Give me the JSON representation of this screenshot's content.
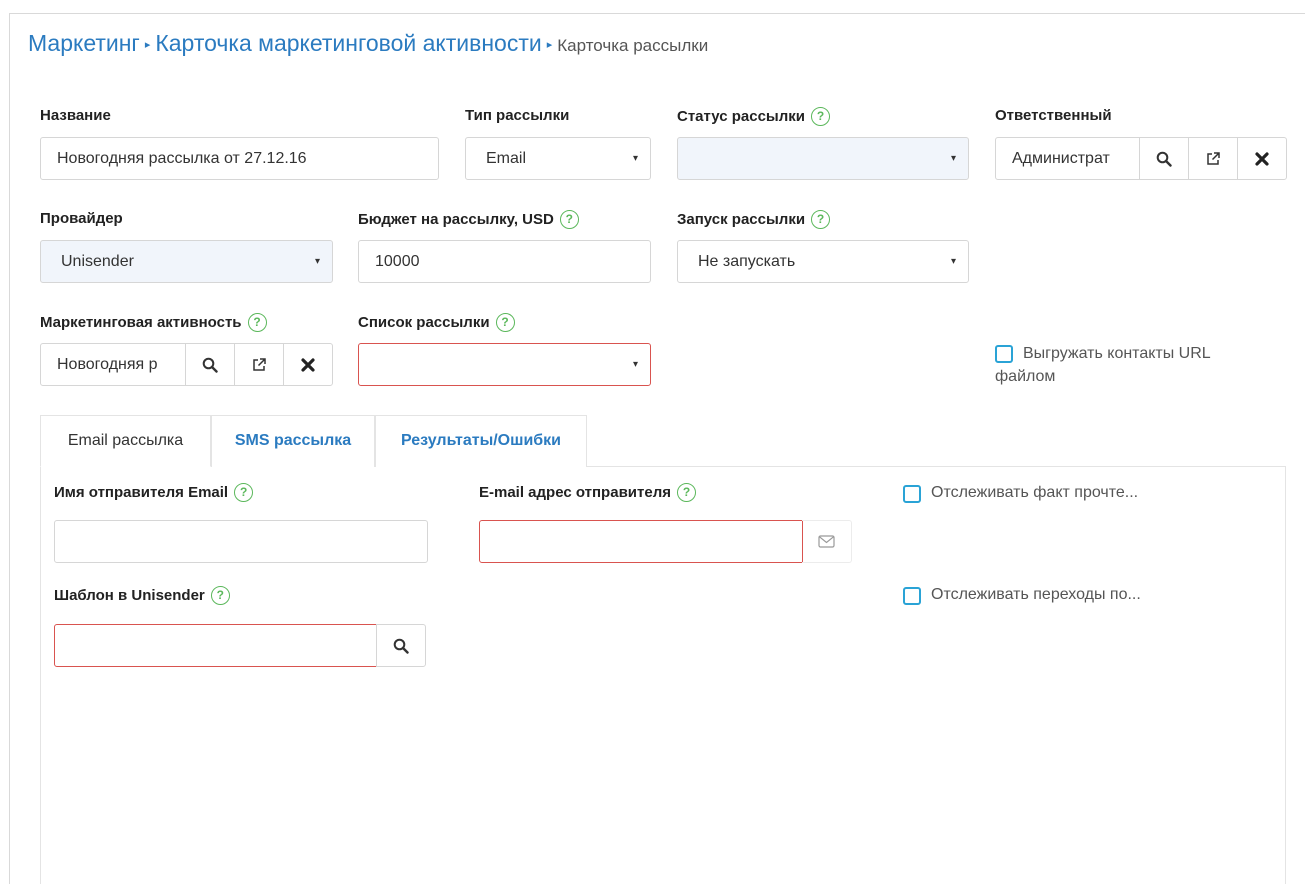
{
  "breadcrumb": {
    "level1": "Маркетинг",
    "level2": "Карточка маркетинговой активности",
    "level3": "Карточка рассылки",
    "separator": "▸"
  },
  "help_glyph": "?",
  "caret_glyph": "▾",
  "form": {
    "name": {
      "label": "Название",
      "value": "Новогодняя рассылка от 27.12.16"
    },
    "type": {
      "label": "Тип рассылки",
      "value": "Email"
    },
    "status": {
      "label": "Статус рассылки",
      "value": ""
    },
    "owner": {
      "label": "Ответственный",
      "value": "Администрат"
    },
    "provider": {
      "label": "Провайдер",
      "value": "Unisender"
    },
    "budget": {
      "label": "Бюджет на рассылку, USD",
      "value": "10000"
    },
    "launch": {
      "label": "Запуск рассылки",
      "value": "Не запускать"
    },
    "activity": {
      "label": "Маркетинговая активность",
      "value": "Новогодняя р"
    },
    "mailing_list": {
      "label": "Список рассылки",
      "value": ""
    },
    "export_contacts": {
      "label_line1": "Выгружать контакты URL",
      "label_line2": "файлом",
      "checked": false
    }
  },
  "tabs": [
    {
      "label": "Email рассылка",
      "active": true
    },
    {
      "label": "SMS рассылка",
      "active": false
    },
    {
      "label": "Результаты/Ошибки",
      "active": false
    }
  ],
  "email_tab": {
    "sender_name": {
      "label": "Имя отправителя Email",
      "value": ""
    },
    "sender_email": {
      "label": "E-mail адрес отправителя",
      "value": ""
    },
    "track_read": {
      "label": "Отслеживать факт прочте...",
      "checked": false
    },
    "template": {
      "label": "Шаблон в Unisender",
      "value": ""
    },
    "track_clicks": {
      "label": "Отслеживать переходы по...",
      "checked": false
    }
  },
  "icons": {
    "search": "search-icon",
    "open": "external-link-icon",
    "clear": "close-icon",
    "mail": "envelope-icon"
  },
  "colors": {
    "link": "#2b7bc0",
    "help": "#5cb85c",
    "error_border": "#d9534f",
    "checkbox": "#2aa3d6"
  }
}
